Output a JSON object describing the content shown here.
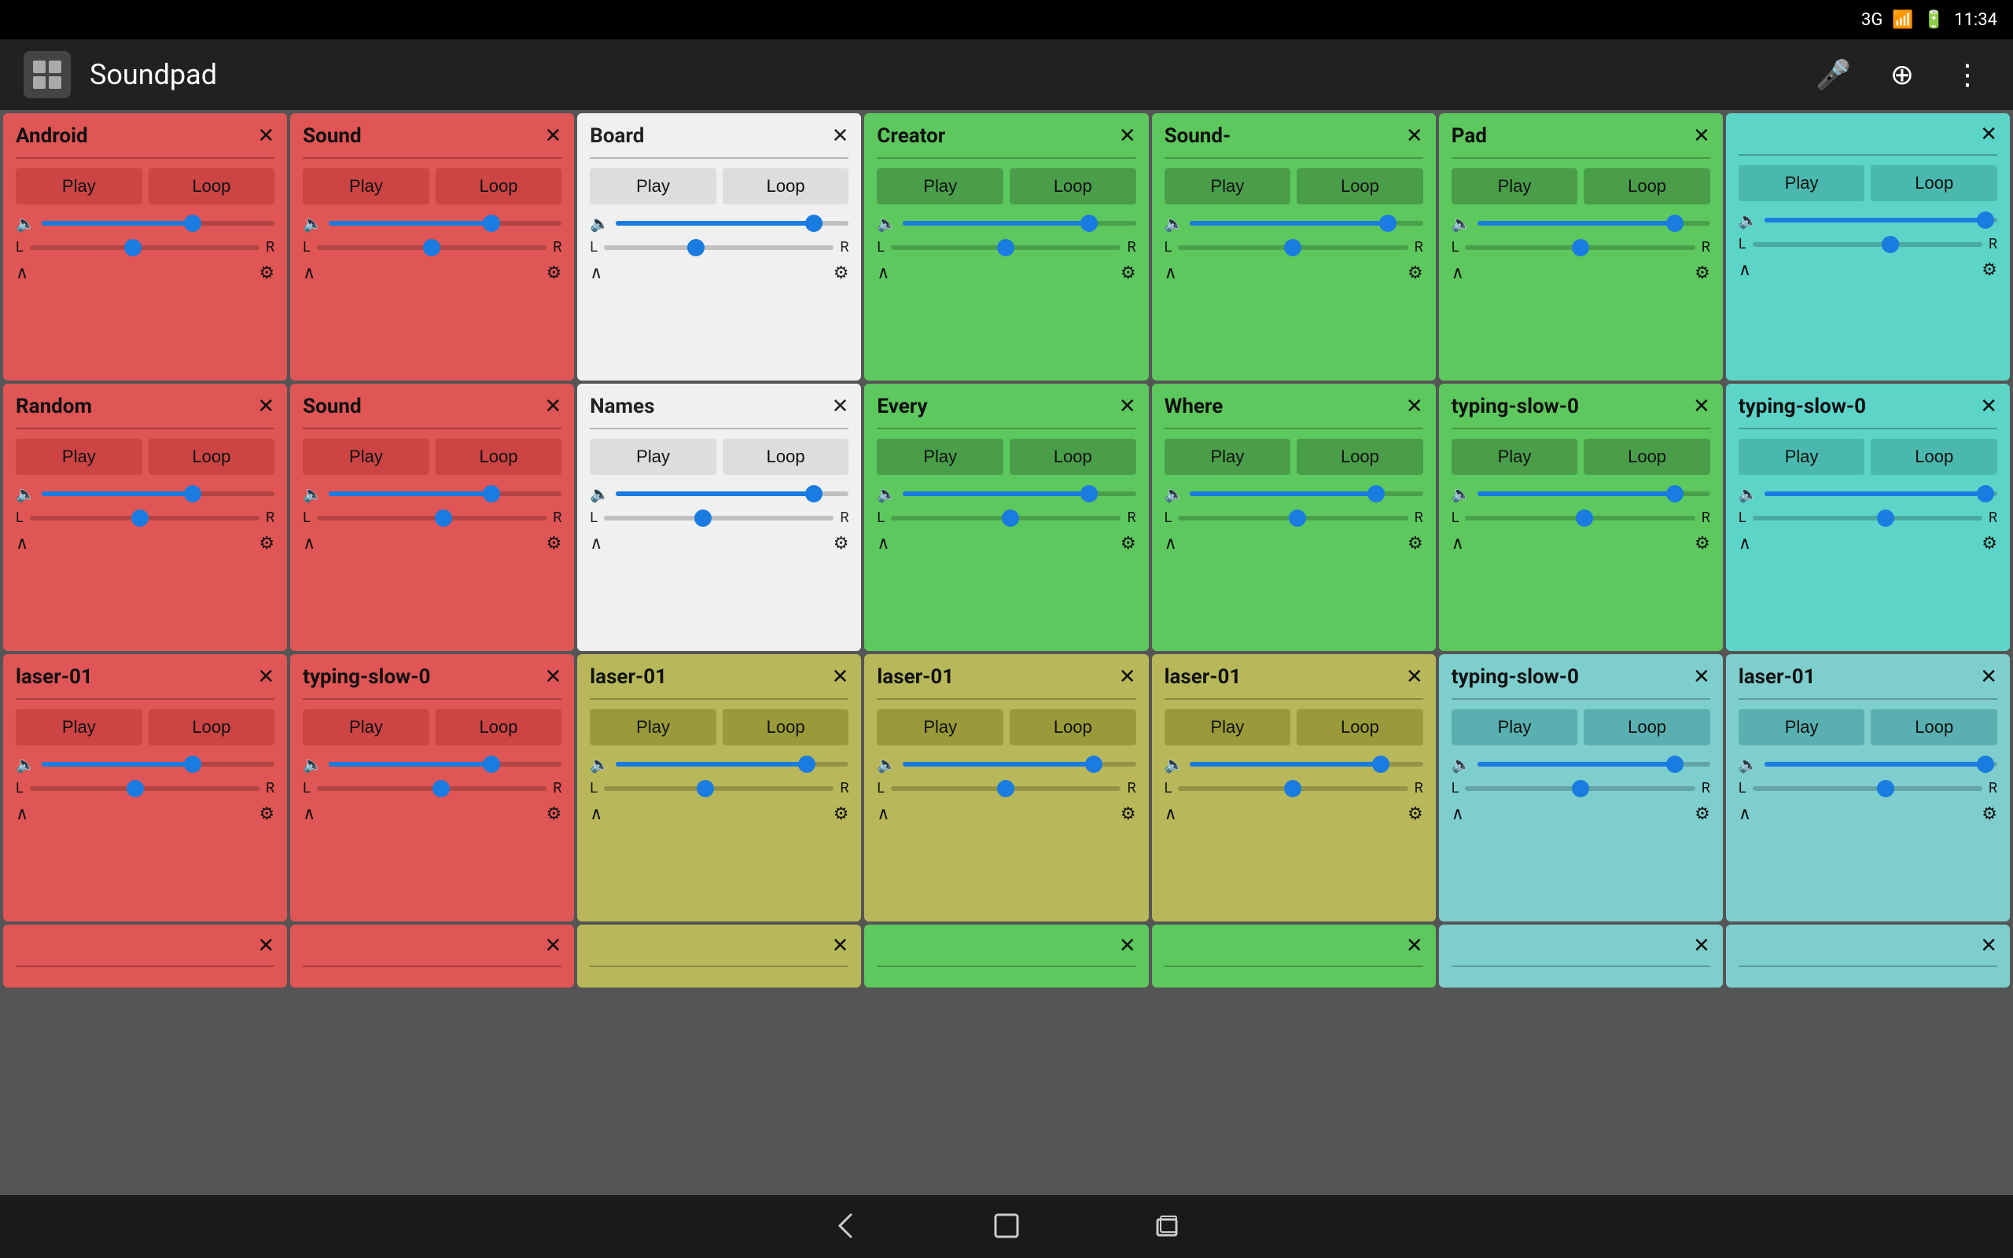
{
  "statusBar": {
    "network": "3G",
    "battery": "🔋",
    "time": "11:34"
  },
  "appBar": {
    "title": "Soundpad",
    "micLabel": "mic",
    "addLabel": "add",
    "menuLabel": "menu"
  },
  "colors": {
    "red": "#e05555",
    "white": "#f0f0f0",
    "green": "#5dc85d",
    "teal": "#5dd4c8",
    "olive": "#b8b85a",
    "teal2": "#7ecece"
  },
  "cards": [
    {
      "title": "Android",
      "color": "red",
      "row": 1
    },
    {
      "title": "Sound",
      "color": "red",
      "row": 1
    },
    {
      "title": "Board",
      "color": "white",
      "row": 1
    },
    {
      "title": "Creator",
      "color": "green",
      "row": 1
    },
    {
      "title": "Sound-",
      "color": "green",
      "row": 1
    },
    {
      "title": "Pad",
      "color": "green",
      "row": 1
    },
    {
      "title": "",
      "color": "teal",
      "row": 1
    },
    {
      "title": "Random",
      "color": "red",
      "row": 2
    },
    {
      "title": "Sound",
      "color": "red",
      "row": 2
    },
    {
      "title": "Names",
      "color": "white",
      "row": 2
    },
    {
      "title": "Every",
      "color": "green",
      "row": 2
    },
    {
      "title": "Where",
      "color": "green",
      "row": 2
    },
    {
      "title": "typing-slow-0",
      "color": "green",
      "row": 2
    },
    {
      "title": "typing-slow-0",
      "color": "teal",
      "row": 2
    },
    {
      "title": "laser-01",
      "color": "red",
      "row": 3
    },
    {
      "title": "typing-slow-0",
      "color": "red",
      "row": 3
    },
    {
      "title": "laser-01",
      "color": "olive",
      "row": 3
    },
    {
      "title": "laser-01",
      "color": "olive",
      "row": 3
    },
    {
      "title": "laser-01",
      "color": "olive",
      "row": 3
    },
    {
      "title": "typing-slow-0",
      "color": "teal2",
      "row": 3
    },
    {
      "title": "laser-01",
      "color": "teal2",
      "row": 3
    },
    {
      "title": "",
      "color": "red",
      "row": 4,
      "partial": true
    },
    {
      "title": "",
      "color": "red",
      "row": 4,
      "partial": true
    },
    {
      "title": "",
      "color": "olive",
      "row": 4,
      "partial": true
    },
    {
      "title": "",
      "color": "green",
      "row": 4,
      "partial": true
    },
    {
      "title": "",
      "color": "green",
      "row": 4,
      "partial": true
    },
    {
      "title": "",
      "color": "teal2",
      "row": 4,
      "partial": true
    },
    {
      "title": "",
      "color": "teal2",
      "row": 4,
      "partial": true
    }
  ],
  "buttons": {
    "play": "Play",
    "loop": "Loop"
  },
  "nav": {
    "back": "←",
    "home": "⬜",
    "recents": "▣"
  }
}
